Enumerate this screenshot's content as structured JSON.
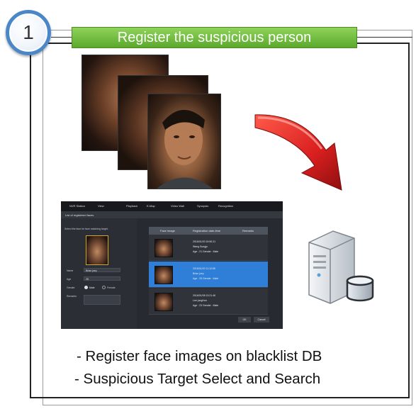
{
  "step": {
    "number": "1",
    "title": "Register the suspicious person"
  },
  "app": {
    "tabs": [
      "NVR Station",
      "View",
      "Playback",
      "E-Map",
      "Video Wall",
      "Synopsis",
      "Recognition"
    ],
    "sub_title": "List of registered faces",
    "instruction": "Select the face for face matching target.",
    "fields": {
      "name_label": "Name",
      "name_value": "Brian joey",
      "age_label": "Age",
      "age_value": "25",
      "gender_label": "Gender",
      "gender_male": "Male",
      "gender_female": "Female",
      "remarks_label": "Remarks"
    },
    "table": {
      "headers": [
        "Face image",
        "Registration date-time",
        "Remarks"
      ],
      "rows": [
        {
          "date": "2016/01/20 19:50:21",
          "name": "Wang Sungjo",
          "info": "Age : 21    Gender : Male"
        },
        {
          "date": "2016/01/20 11:12:55",
          "name": "Brian joey",
          "info": "Age : 25    Gender : Male"
        },
        {
          "date": "2016/01/08 13:21:46",
          "name": "Lee jungHun",
          "info": "Age : 23    Gender : Male"
        }
      ]
    },
    "ok_label": "OK",
    "cancel_label": "Cancel"
  },
  "captions": [
    "- Register face images on blacklist DB",
    "- Suspicious Target Select and Search"
  ],
  "colors": {
    "banner": "#6fbf3f",
    "circle_border": "#4a87c9",
    "arrow": "#d91f1f",
    "selected_row": "#2f7fd8"
  }
}
